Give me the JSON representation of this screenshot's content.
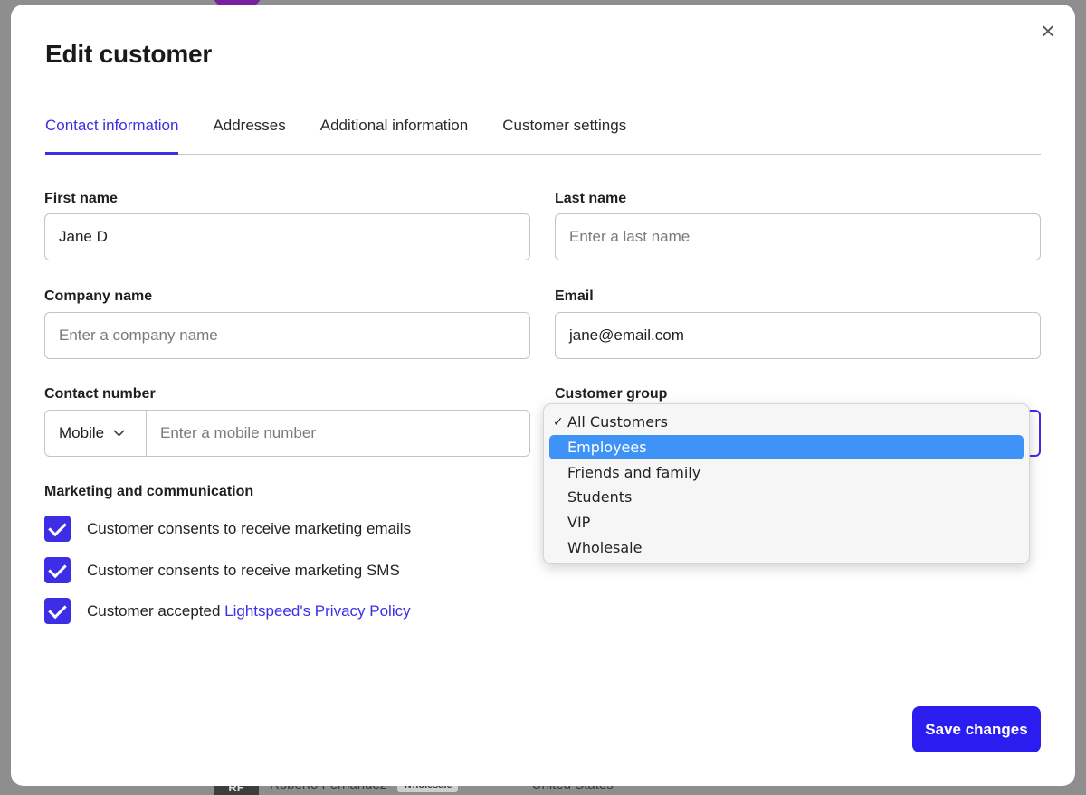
{
  "modal": {
    "title": "Edit customer",
    "close_symbol": "×"
  },
  "tabs": [
    {
      "label": "Contact information",
      "active": true
    },
    {
      "label": "Addresses",
      "active": false
    },
    {
      "label": "Additional information",
      "active": false
    },
    {
      "label": "Customer settings",
      "active": false
    }
  ],
  "form": {
    "first_name": {
      "label": "First name",
      "value": "Jane D"
    },
    "last_name": {
      "label": "Last name",
      "placeholder": "Enter a last name"
    },
    "company_name": {
      "label": "Company name",
      "placeholder": "Enter a company name"
    },
    "email": {
      "label": "Email",
      "value": "jane@email.com"
    },
    "contact_number": {
      "label": "Contact number",
      "type": "Mobile",
      "placeholder": "Enter a mobile number"
    },
    "customer_group": {
      "label": "Customer group",
      "options": [
        "All Customers",
        "Employees",
        "Friends and family",
        "Students",
        "VIP",
        "Wholesale"
      ],
      "checked": "All Customers",
      "highlighted": "Employees"
    }
  },
  "marketing": {
    "heading": "Marketing and communication",
    "email_consent": "Customer consents to receive marketing emails",
    "sms_consent": "Customer consents to receive marketing SMS",
    "privacy_prefix": "Customer accepted ",
    "privacy_link": "Lightspeed's Privacy Policy"
  },
  "actions": {
    "save_label": "Save changes"
  },
  "background": {
    "row_name": "Roberto Fernandez",
    "row_tag": "Wholesale",
    "row_country": "United States",
    "row_avatar": "RF"
  },
  "colors": {
    "accent": "#3d2ee6",
    "button": "#2b1cf0",
    "highlight": "#3f93f6"
  }
}
